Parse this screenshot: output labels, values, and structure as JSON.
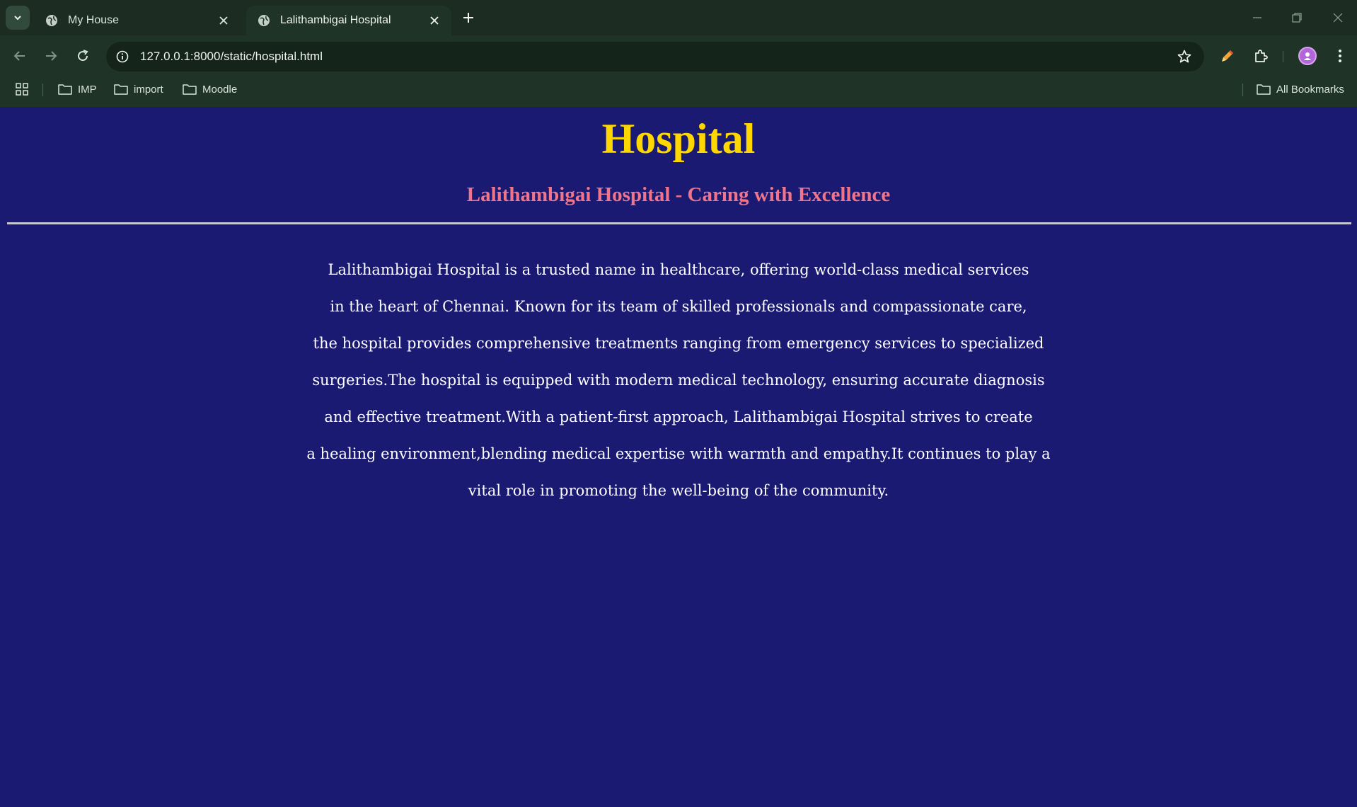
{
  "browser": {
    "tabs": [
      {
        "title": "My House",
        "active": false
      },
      {
        "title": "Lalithambigai Hospital",
        "active": true
      }
    ],
    "url": "127.0.0.1:8000/static/hospital.html",
    "bookmarks": [
      "IMP",
      "import",
      "Moodle"
    ],
    "all_bookmarks_label": "All Bookmarks",
    "icons": [
      "tab-search-icon",
      "globe-icon",
      "close-icon",
      "plus-icon",
      "minimize-icon",
      "restore-icon",
      "back-arrow-icon",
      "forward-arrow-icon",
      "reload-icon",
      "site-info-icon",
      "star-icon",
      "pencil-extension-icon",
      "puzzle-icon",
      "profile-avatar",
      "kebab-menu-icon",
      "apps-grid-icon",
      "folder-icon"
    ]
  },
  "page": {
    "title": "Hospital",
    "subtitle": "Lalithambigai Hospital - Caring with Excellence",
    "paragraph_lines": [
      "Lalithambigai Hospital is a trusted name in healthcare, offering world-class medical services",
      "in the heart of Chennai. Known for its team of skilled professionals and compassionate care,",
      "the hospital provides comprehensive treatments ranging from emergency services to specialized",
      "surgeries.The hospital is equipped with modern medical technology, ensuring accurate diagnosis",
      "and effective treatment.With a patient-first approach, Lalithambigai Hospital strives to create",
      "a healing environment,blending medical expertise with warmth and empathy.It continues to play a",
      "vital role in promoting the well-being of the community."
    ]
  },
  "colors": {
    "page_background": "#1a1a73",
    "title": "#ffd700",
    "subtitle": "#f0758a",
    "body_text": "#ffffff",
    "chrome": "#1f3327"
  }
}
